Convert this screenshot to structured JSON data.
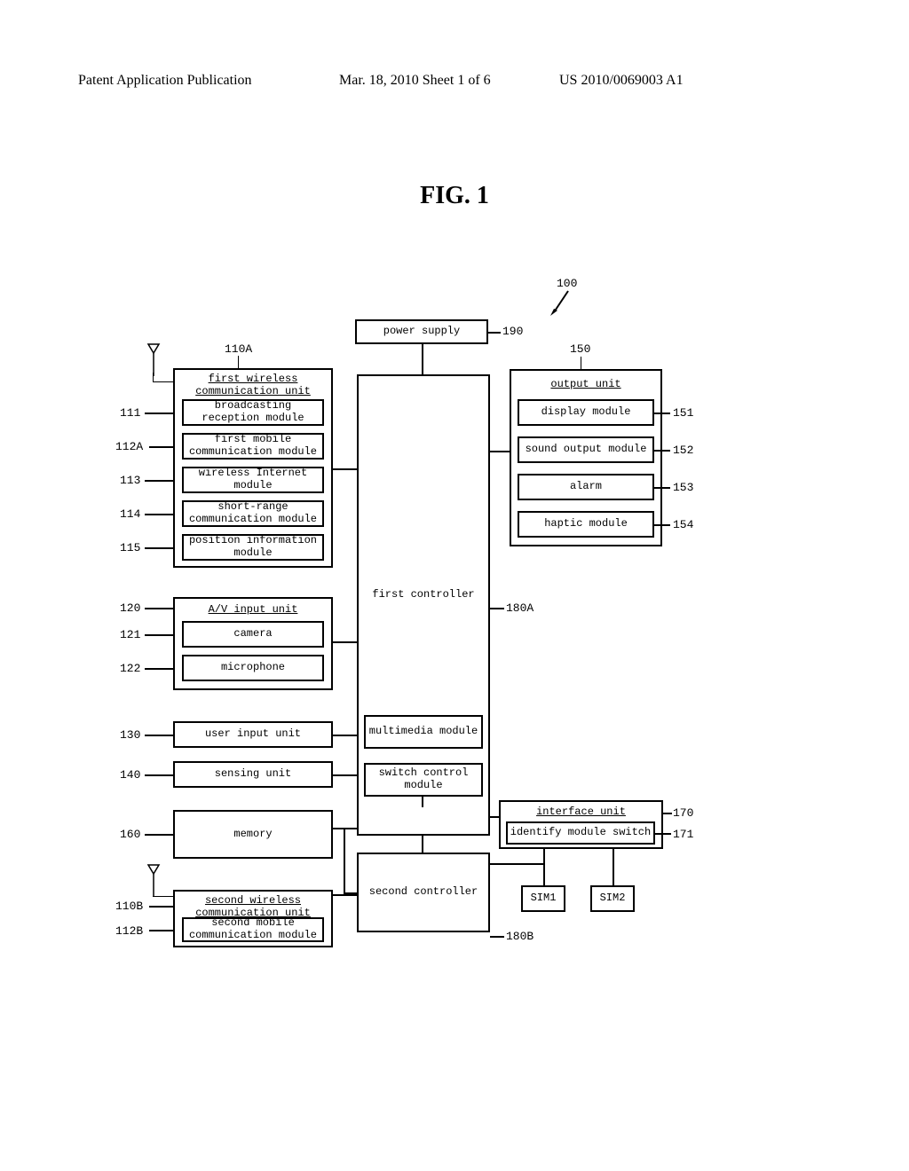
{
  "header": {
    "left": "Patent Application Publication",
    "middle": "Mar. 18, 2010  Sheet 1 of 6",
    "right": "US 2010/0069003 A1"
  },
  "figure_title": "FIG. 1",
  "refs": {
    "r100": "100",
    "r190": "190",
    "r110A": "110A",
    "r150": "150",
    "r111": "111",
    "r112A": "112A",
    "r113": "113",
    "r114": "114",
    "r115": "115",
    "r151": "151",
    "r152": "152",
    "r153": "153",
    "r154": "154",
    "r120": "120",
    "r121": "121",
    "r122": "122",
    "r130": "130",
    "r140": "140",
    "r160": "160",
    "r170": "170",
    "r171": "171",
    "r180A": "180A",
    "r110B": "110B",
    "r112B": "112B",
    "r180B": "180B"
  },
  "blocks": {
    "power_supply": "power supply",
    "first_wireless_unit": "first wireless\ncommunication unit",
    "broadcasting": "broadcasting\nreception module",
    "first_mobile": "first mobile\ncommunication module",
    "wireless_internet": "wireless Internet\nmodule",
    "short_range": "short-range\ncommunication module",
    "position_info": "position information\nmodule",
    "av_input": "A/V input unit",
    "camera": "camera",
    "microphone": "microphone",
    "user_input": "user input unit",
    "sensing": "sensing unit",
    "memory": "memory",
    "second_wireless_unit": "second wireless\ncommunication unit",
    "second_mobile": "second mobile\ncommunication module",
    "first_controller": "first controller",
    "multimedia": "multimedia module",
    "switch_control": "switch control\nmodule",
    "second_controller": "second controller",
    "output_unit": "output unit",
    "display": "display module",
    "sound": "sound output module",
    "alarm": "alarm",
    "haptic": "haptic module",
    "interface_unit": "interface unit",
    "identify_switch": "identify module switch",
    "sim1": "SIM1",
    "sim2": "SIM2"
  }
}
